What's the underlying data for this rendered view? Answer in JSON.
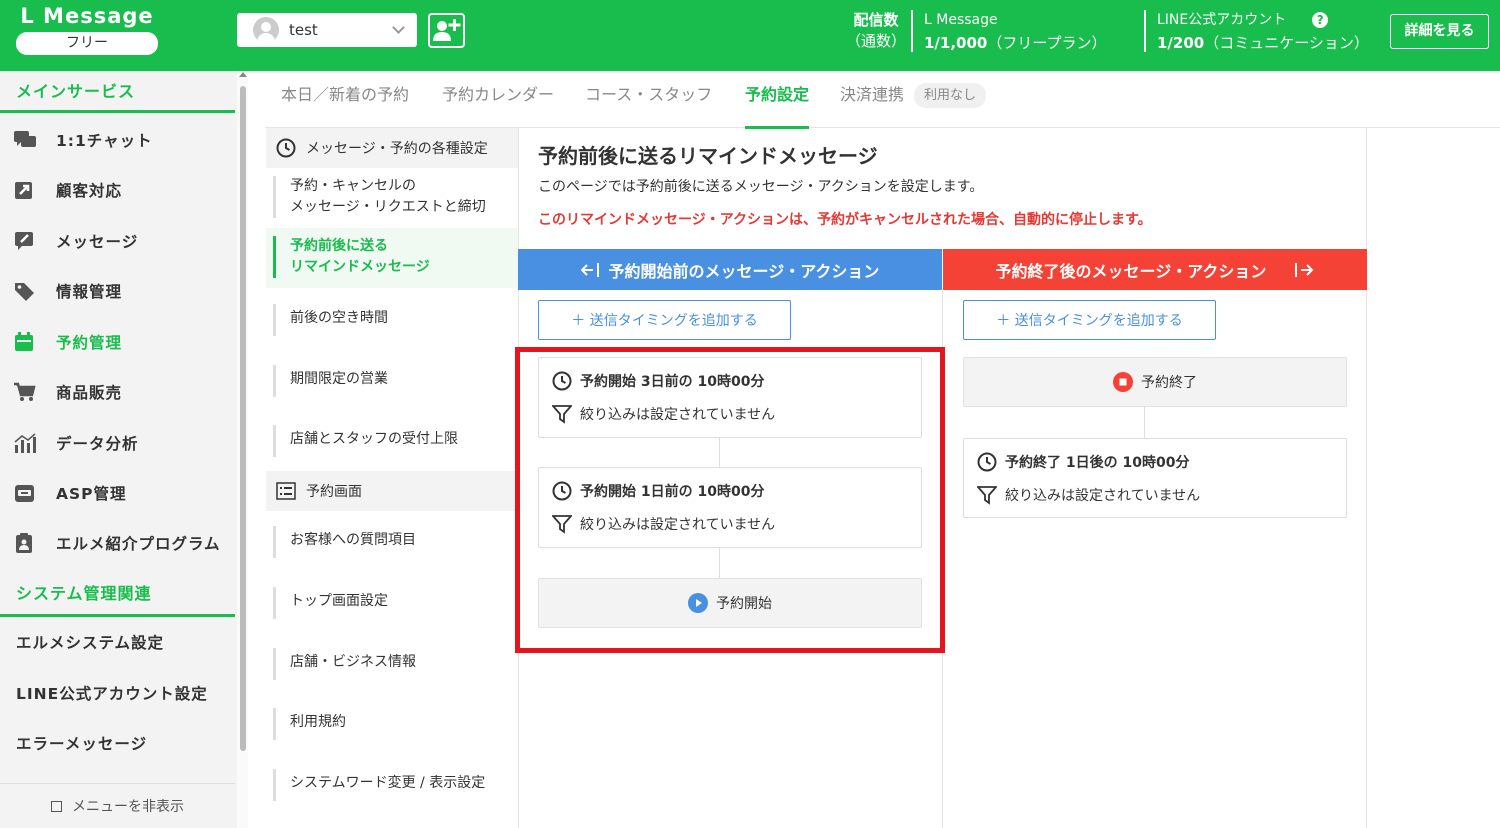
{
  "header": {
    "logo_title": "L Message",
    "logo_plan": "フリー",
    "account_name": "test",
    "stat_label_1": "配信数",
    "stat_label_2": "（通数）",
    "lmessage_label": "L Message",
    "lmessage_value": "1/1,000",
    "lmessage_plan": "（フリープラン）",
    "line_label": "LINE公式アカウント",
    "line_value": "1/200",
    "line_plan": "（コミュニケーション）",
    "help": "?",
    "detail_button": "詳細を見る",
    "brand_color": "#19bd4d"
  },
  "sidebar": {
    "section_main": "メインサービス",
    "items": [
      {
        "label": "1:1チャット",
        "icon": "chat-icon"
      },
      {
        "label": "顧客対応",
        "icon": "external-link-icon"
      },
      {
        "label": "メッセージ",
        "icon": "message-edit-icon"
      },
      {
        "label": "情報管理",
        "icon": "tag-icon"
      },
      {
        "label": "予約管理",
        "icon": "calendar-icon"
      },
      {
        "label": "商品販売",
        "icon": "cart-icon"
      },
      {
        "label": "データ分析",
        "icon": "bar-chart-icon"
      },
      {
        "label": "ASP管理",
        "icon": "asp-icon"
      },
      {
        "label": "エルメ紹介プログラム",
        "icon": "clipboard-user-icon"
      }
    ],
    "section_system": "システム管理関連",
    "system_items": [
      "エルメシステム設定",
      "LINE公式アカウント設定",
      "エラーメッセージ"
    ],
    "hide_menu": "メニューを非表示"
  },
  "tabs": [
    "本日／新着の予約",
    "予約カレンダー",
    "コース・スタッフ",
    "予約設定",
    "決済連携"
  ],
  "tab_badge": "利用なし",
  "subnav": {
    "head1": "メッセージ・予約の各種設定",
    "item1_line1": "予約・キャンセルの",
    "item1_line2": "メッセージ・リクエストと締切",
    "item2_line1": "予約前後に送る",
    "item2_line2": "リマインドメッセージ",
    "item3": "前後の空き時間",
    "item4": "期間限定の営業",
    "item5": "店舗とスタッフの受付上限",
    "head2": "予約画面",
    "item6": "お客様への質問項目",
    "item7": "トップ画面設定",
    "item8": "店舗・ビジネス情報",
    "item9": "利用規約",
    "item10": "システムワード変更 / 表示設定"
  },
  "content": {
    "title": "予約前後に送るリマインドメッセージ",
    "description": "このページでは予約前後に送るメッセージ・アクションを設定します。",
    "warning": "このリマインドメッセージ・アクションは、予約がキャンセルされた場合、自動的に停止します。",
    "before": {
      "header": "予約開始前のメッセージ・アクション",
      "add_button": "＋ 送信タイミングを追加する",
      "cards": [
        {
          "timing": "予約開始 3日前の 10時00分",
          "filter": "絞り込みは設定されていません"
        },
        {
          "timing": "予約開始 1日前の 10時00分",
          "filter": "絞り込みは設定されていません"
        }
      ],
      "end_label": "予約開始"
    },
    "after": {
      "header": "予約終了後のメッセージ・アクション",
      "add_button": "＋ 送信タイミングを追加する",
      "end_label": "予約終了",
      "cards": [
        {
          "timing": "予約終了 1日後の 10時00分",
          "filter": "絞り込みは設定されていません"
        }
      ]
    },
    "colors": {
      "before_header": "#4a90e2",
      "after_header": "#f44336",
      "warning": "#e53935",
      "highlight": "#e3161e"
    }
  }
}
